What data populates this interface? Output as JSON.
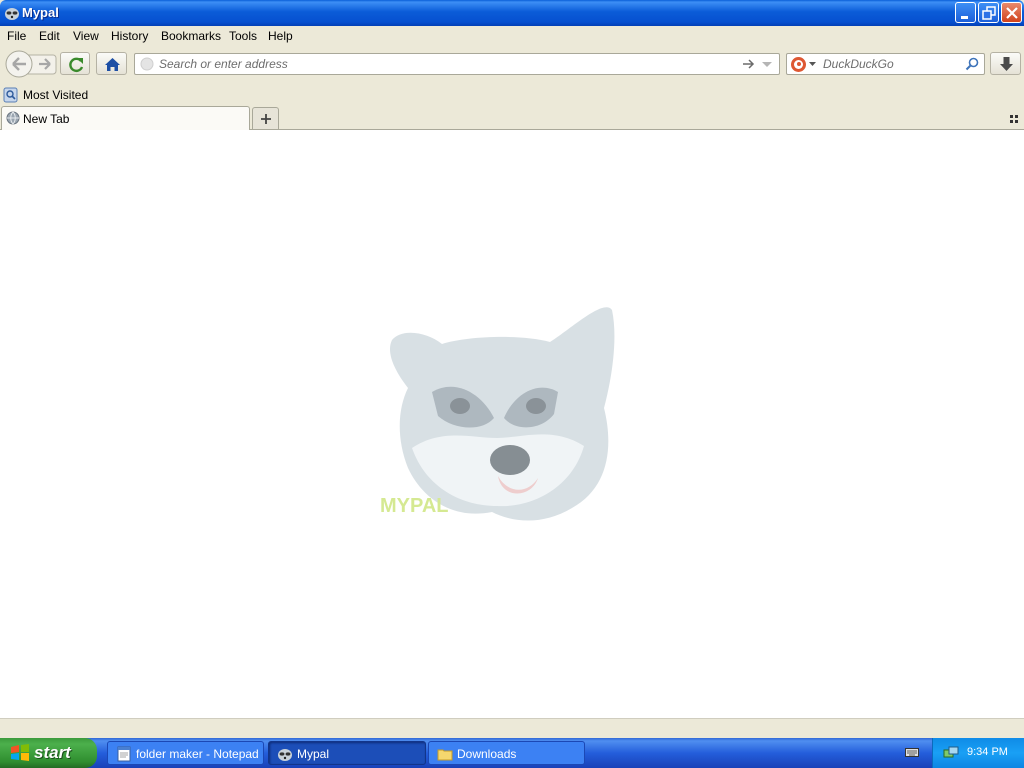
{
  "window": {
    "title": "Mypal"
  },
  "menu": [
    "File",
    "Edit",
    "View",
    "History",
    "Bookmarks",
    "Tools",
    "Help"
  ],
  "toolbar": {
    "url_placeholder": "Search or enter address",
    "search_engine": "DuckDuckGo",
    "search_placeholder": "DuckDuckGo"
  },
  "bookmarks": {
    "most_visited": "Most Visited"
  },
  "tabs": [
    {
      "label": "New Tab",
      "active": true
    }
  ],
  "content": {
    "logo_text": "MYPAL"
  },
  "taskbar": {
    "start_label": "start",
    "tasks": [
      {
        "label": "folder maker - Notepad",
        "active": false
      },
      {
        "label": "Mypal",
        "active": true
      },
      {
        "label": "Downloads",
        "active": false
      }
    ],
    "clock": "9:34 PM"
  },
  "colors": {
    "titlebar": "#0a5fd8",
    "taskbar": "#245edb",
    "start": "#3c9a3c",
    "tray": "#0f8be7"
  }
}
